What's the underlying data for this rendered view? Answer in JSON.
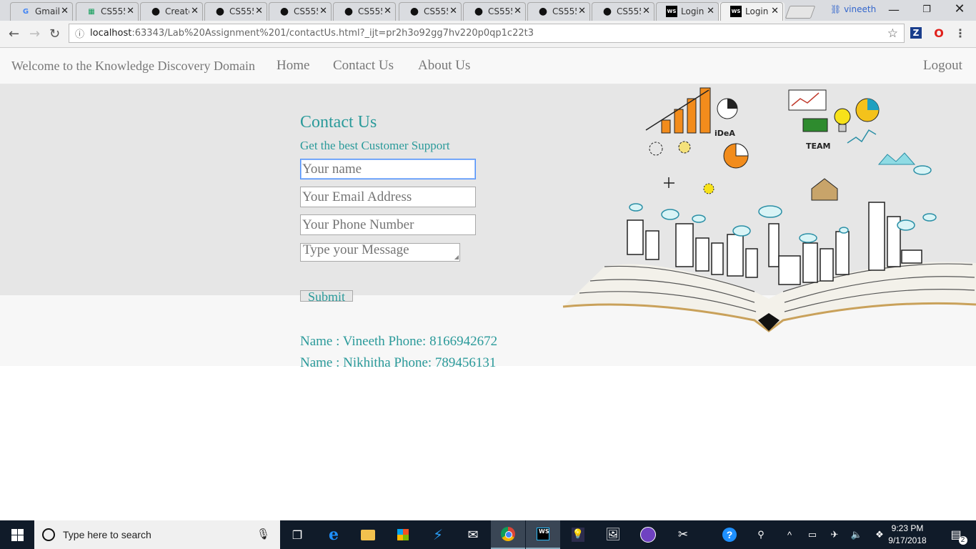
{
  "browser": {
    "tabs": [
      {
        "title": "Gmail",
        "icon": "google-icon"
      },
      {
        "title": "CS555",
        "icon": "sheets-icon"
      },
      {
        "title": "Create",
        "icon": "github-icon"
      },
      {
        "title": "CS555",
        "icon": "github-icon"
      },
      {
        "title": "CS555",
        "icon": "github-icon"
      },
      {
        "title": "CS555",
        "icon": "github-icon"
      },
      {
        "title": "CS555",
        "icon": "github-icon"
      },
      {
        "title": "CS555",
        "icon": "github-icon"
      },
      {
        "title": "CS555",
        "icon": "github-icon"
      },
      {
        "title": "CS555",
        "icon": "github-icon"
      },
      {
        "title": "Login",
        "icon": "webstorm-icon"
      },
      {
        "title": "Login",
        "icon": "webstorm-icon",
        "active": true
      }
    ],
    "profile_name": "vineeth",
    "url_host": "localhost",
    "url_rest": ":63343/Lab%20Assignment%201/contactUs.html?_ijt=pr2h3o92gg7hv220p0qp1c22t3",
    "colors": {
      "tabstrip": "#dadce0",
      "toolbar": "#f2f2f2"
    }
  },
  "navbar": {
    "brand": "Welcome to the Knowledge Discovery Domain",
    "links": [
      "Home",
      "Contact Us",
      "About Us"
    ],
    "logout": "Logout"
  },
  "contact": {
    "heading": "Contact Us",
    "subheading": "Get the best Customer Support",
    "name_placeholder": "Your name",
    "email_placeholder": "Your Email Address",
    "phone_placeholder": "Your Phone Number",
    "message_placeholder": "Type your Message",
    "submit_label": "Submit",
    "entries": [
      "Name : Vineeth Phone: 8166942672",
      "Name : Nikhitha Phone: 789456131"
    ],
    "colors": {
      "accent": "#2a9a9a",
      "jumbotron": "#e6e6e6"
    }
  },
  "taskbar": {
    "search_placeholder": "Type here to search",
    "time": "9:23 PM",
    "date": "9/17/2018",
    "notification_count": "2"
  }
}
